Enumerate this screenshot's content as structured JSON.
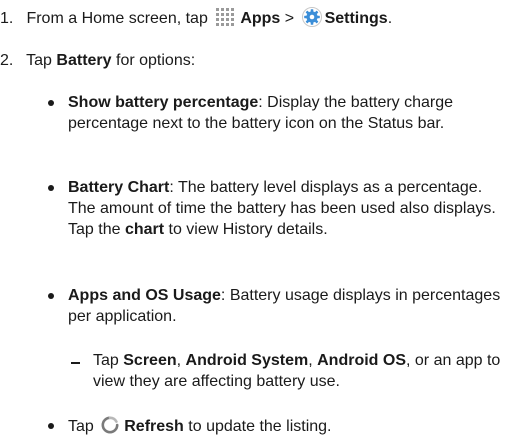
{
  "step1": {
    "number": "1.",
    "prefix": "From a Home screen, tap",
    "apps": "Apps",
    "separator": ">",
    "settings": "Settings",
    "end": ".",
    "apps_icon": "apps-grid-icon",
    "settings_icon": "settings-gear-icon"
  },
  "step2": {
    "number": "2.",
    "prefix": "Tap",
    "battery": "Battery",
    "suffix": "for options:"
  },
  "bullets": {
    "percentage": {
      "title": "Show battery percentage",
      "text": ": Display the battery charge percentage next to the battery icon on the Status bar."
    },
    "chart": {
      "title": "Battery Chart",
      "text1": ": The battery level displays as a percentage. The amount of time the battery has been used also displays. Tap the",
      "chart_word": "chart",
      "text2": "to view History details."
    },
    "usage": {
      "title": "Apps and OS Usage",
      "text": ": Battery usage displays in percentages per application."
    },
    "usage_sub": {
      "prefix": "Tap",
      "screen": "Screen",
      "comma1": ",",
      "android_system": "Android System",
      "comma2": ",",
      "android_os": "Android OS",
      "suffix": ", or an app to view they are affecting battery use."
    },
    "refresh": {
      "prefix": "Tap",
      "label": "Refresh",
      "suffix": "to update the listing.",
      "icon": "refresh-icon"
    }
  },
  "colors": {
    "text": "#1a1a1a",
    "apps_icon_dots": "#9a9a9a",
    "settings_icon_blue": "#3b8ed8",
    "refresh_icon": "#7a7a7a"
  }
}
